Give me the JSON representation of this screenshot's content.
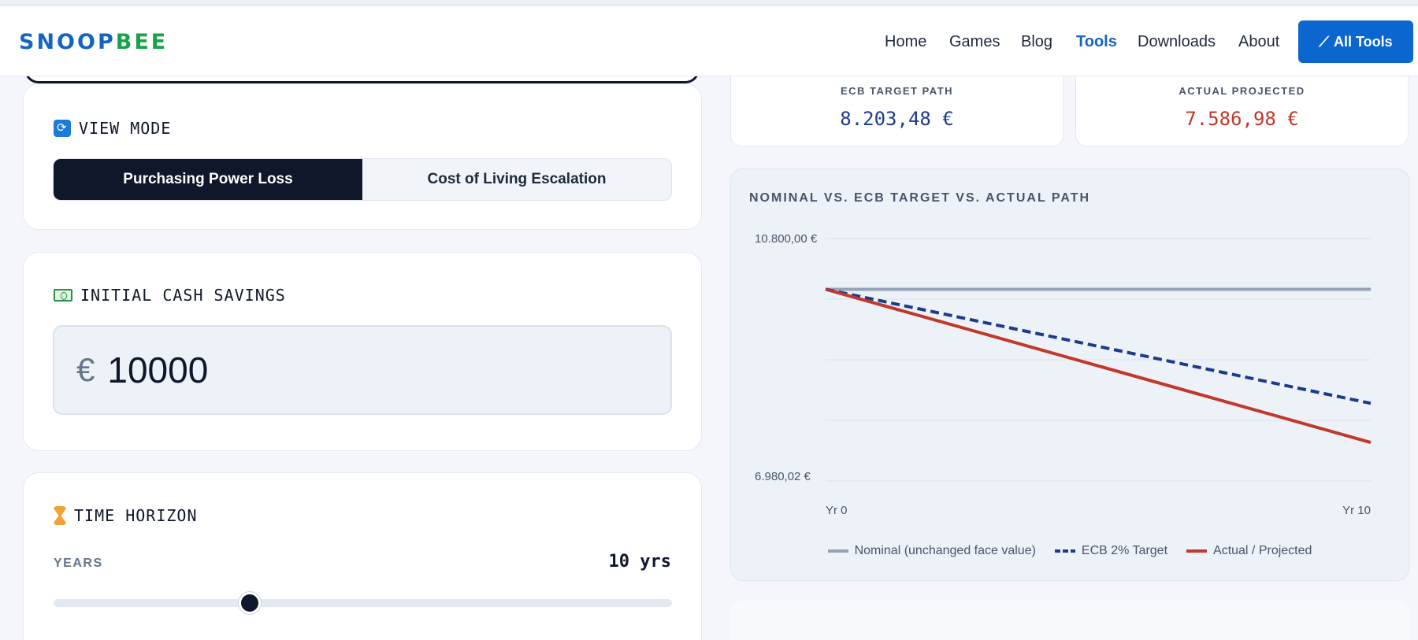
{
  "header": {
    "logo_part1": "SNOOP",
    "logo_part2": "BEE",
    "nav": [
      "Home",
      "Games",
      "Blog",
      "Tools",
      "Downloads",
      "About"
    ],
    "active_nav": "Tools",
    "all_tools": "All Tools"
  },
  "view_mode": {
    "title": "VIEW MODE",
    "options": [
      "Purchasing Power Loss",
      "Cost of Living Escalation"
    ],
    "selected": "Purchasing Power Loss"
  },
  "savings": {
    "title": "INITIAL CASH SAVINGS",
    "currency": "€",
    "value": "10000"
  },
  "horizon": {
    "title": "TIME HORIZON",
    "label": "YEARS",
    "value_text": "10 yrs",
    "slider_fraction": 0.317
  },
  "stats": {
    "ecb_label": "ECB TARGET PATH",
    "ecb_value": "8.203,48 €",
    "actual_label": "ACTUAL PROJECTED",
    "actual_value": "7.586,98 €"
  },
  "chart": {
    "title": "NOMINAL VS. ECB TARGET VS. ACTUAL PATH",
    "legend": [
      "Nominal (unchanged face value)",
      "ECB 2% Target",
      "Actual / Projected"
    ]
  },
  "colors": {
    "accent": "#0b66d0",
    "ecb": "#1e3a8a",
    "actual": "#c0392b",
    "nominal": "#94a3b8"
  },
  "chart_data": {
    "type": "line",
    "x": [
      0,
      10
    ],
    "xticklabels": [
      "Yr 0",
      "Yr 10"
    ],
    "yticklabels": [
      "10.800,00 €",
      "6.980,02 €"
    ],
    "ylim": [
      6980.02,
      10800
    ],
    "series": [
      {
        "name": "Nominal (unchanged face value)",
        "values": [
          10000,
          10000
        ]
      },
      {
        "name": "ECB 2% Target",
        "values": [
          10000,
          8203.48
        ]
      },
      {
        "name": "Actual / Projected",
        "values": [
          10000,
          7586.98
        ]
      }
    ],
    "legend_position": "bottom",
    "grid": true
  }
}
